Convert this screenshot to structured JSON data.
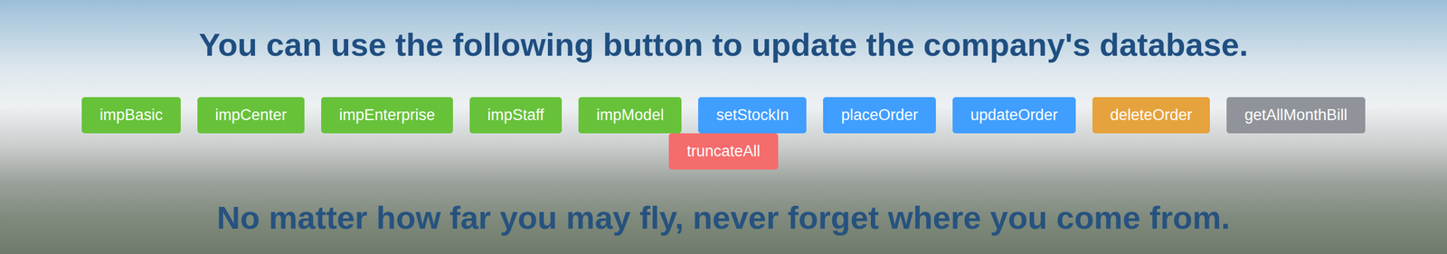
{
  "heading": "You can use the following button to update the company's database.",
  "buttons": [
    {
      "label": "impBasic",
      "color": "#67c23a"
    },
    {
      "label": "impCenter",
      "color": "#67c23a"
    },
    {
      "label": "impEnterprise",
      "color": "#67c23a"
    },
    {
      "label": "impStaff",
      "color": "#67c23a"
    },
    {
      "label": "impModel",
      "color": "#67c23a"
    },
    {
      "label": "setStockIn",
      "color": "#409eff"
    },
    {
      "label": "placeOrder",
      "color": "#409eff"
    },
    {
      "label": "updateOrder",
      "color": "#409eff"
    },
    {
      "label": "deleteOrder",
      "color": "#e6a23c"
    },
    {
      "label": "getAllMonthBill",
      "color": "#909399"
    },
    {
      "label": "truncateAll",
      "color": "#f56c6c"
    }
  ],
  "quote": "No matter how far you may fly, never forget where you come from."
}
